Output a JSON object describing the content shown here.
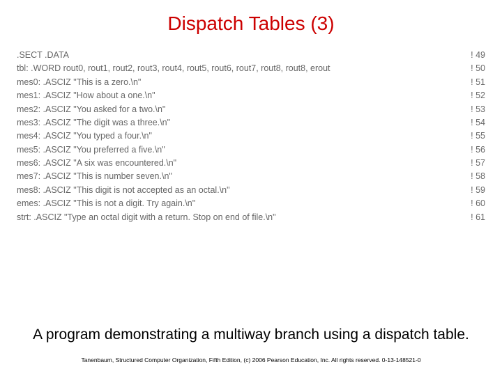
{
  "title": "Dispatch Tables (3)",
  "code": [
    {
      "left": ".SECT  .DATA",
      "right": "! 49"
    },
    {
      "left": "tbl:  .WORD rout0, rout1, rout2, rout3, rout4, rout5, rout6, rout7, rout8, rout8, erout",
      "right": "! 50"
    },
    {
      "left": "mes0: .ASCIZ \"This is a zero.\\n\"",
      "right": "! 51"
    },
    {
      "left": "mes1: .ASCIZ \"How about a one.\\n\"",
      "right": "! 52"
    },
    {
      "left": "mes2: .ASCIZ \"You asked for a two.\\n\"",
      "right": "! 53"
    },
    {
      "left": "mes3: .ASCIZ \"The digit was a three.\\n\"",
      "right": "! 54"
    },
    {
      "left": "mes4: .ASCIZ \"You typed a four.\\n\"",
      "right": "! 55"
    },
    {
      "left": "mes5: .ASCIZ \"You preferred a five.\\n\"",
      "right": "! 56"
    },
    {
      "left": "mes6: .ASCIZ \"A six was encountered.\\n\"",
      "right": "! 57"
    },
    {
      "left": "mes7: .ASCIZ \"This is number seven.\\n\"",
      "right": "! 58"
    },
    {
      "left": "mes8: .ASCIZ \"This digit is not accepted as an octal.\\n\"",
      "right": "! 59"
    },
    {
      "left": "emes: .ASCIZ \"This is not a digit. Try again.\\n\"",
      "right": "! 60"
    },
    {
      "left": "strt:   .ASCIZ \"Type an octal digit with a return. Stop on end of file.\\n\"",
      "right": "! 61"
    }
  ],
  "caption": "A program demonstrating a multiway branch using a dispatch table.",
  "footer": "Tanenbaum, Structured Computer Organization, Fifth Edition, (c) 2006 Pearson Education, Inc. All rights reserved. 0-13-148521-0"
}
